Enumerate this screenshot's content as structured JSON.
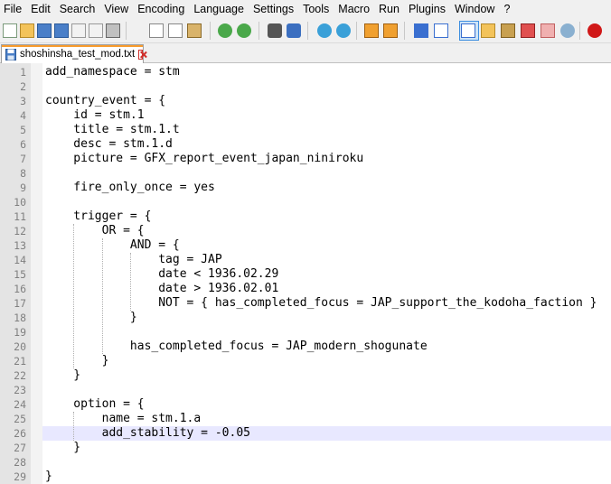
{
  "menu": [
    "File",
    "Edit",
    "Search",
    "View",
    "Encoding",
    "Language",
    "Settings",
    "Tools",
    "Macro",
    "Run",
    "Plugins",
    "Window",
    "?"
  ],
  "toolbar_icons": [
    "new-file-icon",
    "open-file-icon",
    "save-icon",
    "save-all-icon",
    "close-icon",
    "close-all-icon",
    "print-icon",
    "cut-icon",
    "copy-icon",
    "paste-icon",
    "undo-icon",
    "redo-icon",
    "find-icon",
    "replace-icon",
    "zoom-in-icon",
    "zoom-out-icon",
    "sync-vertical-icon",
    "sync-horizontal-icon",
    "word-wrap-icon",
    "show-all-characters-icon",
    "indent-guide-icon",
    "language-define-icon",
    "document-map-icon",
    "function-list-icon",
    "folder-as-workspace-icon",
    "monitoring-icon",
    "record-macro-icon"
  ],
  "tab": {
    "label": "shoshinsha_test_mod.txt"
  },
  "editor": {
    "current_line": 26,
    "lines": [
      "add_namespace = stm",
      "",
      "country_event = {",
      "    id = stm.1",
      "    title = stm.1.t",
      "    desc = stm.1.d",
      "    picture = GFX_report_event_japan_niniroku",
      "",
      "    fire_only_once = yes",
      "",
      "    trigger = {",
      "        OR = {",
      "            AND = {",
      "                tag = JAP",
      "                date < 1936.02.29",
      "                date > 1936.02.01",
      "                NOT = { has_completed_focus = JAP_support_the_kodoha_faction }",
      "            }",
      "",
      "            has_completed_focus = JAP_modern_shogunate",
      "        }",
      "    }",
      "",
      "    option = {",
      "        name = stm.1.a",
      "        add_stability = -0.05",
      "    }",
      "",
      "}"
    ]
  },
  "colors": {
    "current_line": "#e8e8ff",
    "tab_accent": "#f89b2c",
    "gutter": "#e4e4e4"
  }
}
